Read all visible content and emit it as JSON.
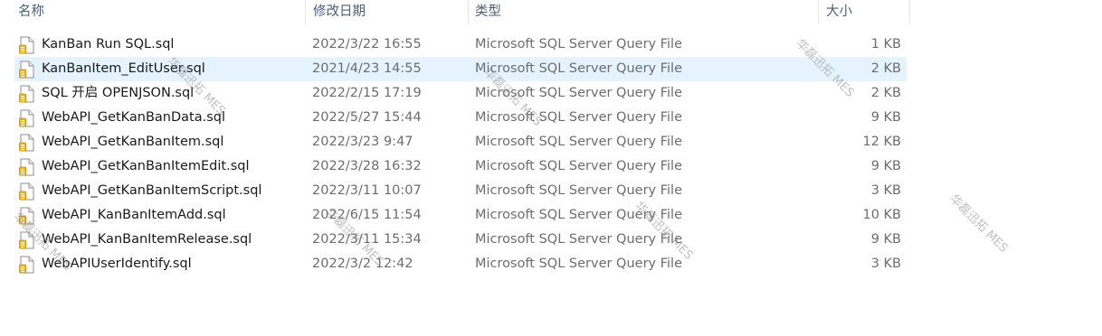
{
  "columns": {
    "name": "名称",
    "date": "修改日期",
    "type": "类型",
    "size": "大小"
  },
  "files": [
    {
      "name": "KanBan Run SQL.sql",
      "date": "2022/3/22 16:55",
      "type": "Microsoft SQL Server Query File",
      "size": "1 KB",
      "icon": "sql-file-icon"
    },
    {
      "name": "KanBanItem_EditUser.sql",
      "date": "2021/4/23 14:55",
      "type": "Microsoft SQL Server Query File",
      "size": "2 KB",
      "icon": "sql-file-icon"
    },
    {
      "name": "SQL 开启 OPENJSON.sql",
      "date": "2022/2/15 17:19",
      "type": "Microsoft SQL Server Query File",
      "size": "2 KB",
      "icon": "sql-file-icon"
    },
    {
      "name": "WebAPI_GetKanBanData.sql",
      "date": "2022/5/27 15:44",
      "type": "Microsoft SQL Server Query File",
      "size": "9 KB",
      "icon": "sql-file-icon"
    },
    {
      "name": "WebAPI_GetKanBanItem.sql",
      "date": "2022/3/23 9:47",
      "type": "Microsoft SQL Server Query File",
      "size": "12 KB",
      "icon": "sql-file-icon"
    },
    {
      "name": "WebAPI_GetKanBanItemEdit.sql",
      "date": "2022/3/28 16:32",
      "type": "Microsoft SQL Server Query File",
      "size": "9 KB",
      "icon": "sql-file-icon"
    },
    {
      "name": "WebAPI_GetKanBanItemScript.sql",
      "date": "2022/3/11 10:07",
      "type": "Microsoft SQL Server Query File",
      "size": "3 KB",
      "icon": "sql-file-icon"
    },
    {
      "name": "WebAPI_KanBanItemAdd.sql",
      "date": "2022/6/15 11:54",
      "type": "Microsoft SQL Server Query File",
      "size": "10 KB",
      "icon": "sql-file-icon"
    },
    {
      "name": "WebAPI_KanBanItemRelease.sql",
      "date": "2022/3/11 15:34",
      "type": "Microsoft SQL Server Query File",
      "size": "9 KB",
      "icon": "sql-file-icon"
    },
    {
      "name": "WebAPIUserIdentify.sql",
      "date": "2022/3/2 12:42",
      "type": "Microsoft SQL Server Query File",
      "size": "3 KB",
      "icon": "sql-file-icon"
    }
  ],
  "watermark": "华磊迅拓 MES"
}
